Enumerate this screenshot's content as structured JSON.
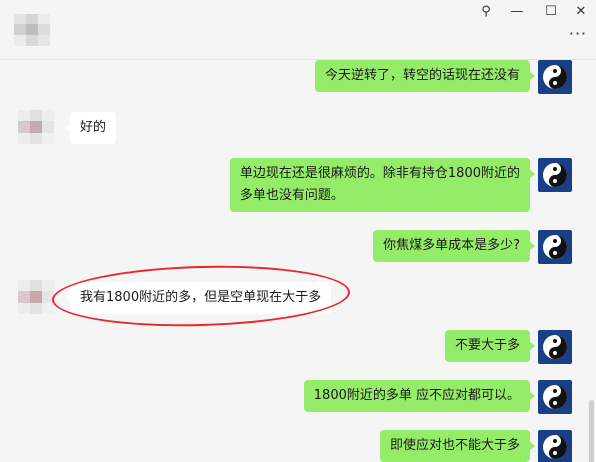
{
  "window": {
    "pin_icon": "pin-icon",
    "minimize_icon": "minimize-icon",
    "maximize_icon": "maximize-icon",
    "close_icon": "close-icon",
    "more_icon": "more-icon"
  },
  "colors": {
    "outgoing_bubble": "#95ec69",
    "incoming_bubble": "#ffffff",
    "background": "#f5f5f5",
    "annotation": "#e8262b"
  },
  "messages": [
    {
      "side": "out",
      "text": "今天逆转了，转空的话现在还没有"
    },
    {
      "side": "in",
      "text": "好的"
    },
    {
      "side": "out",
      "text": "单边现在还是很麻烦的。除非有持仓1800附近的",
      "text2": "多单也没有问题。"
    },
    {
      "side": "out",
      "text": "你焦煤多单成本是多少?"
    },
    {
      "side": "in",
      "text": "我有1800附近的多，但是空单现在大于多"
    },
    {
      "side": "out",
      "text": "不要大于多"
    },
    {
      "side": "out",
      "text": "1800附近的多单 应不应对都可以。"
    },
    {
      "side": "out",
      "text": "即使应对也不能大于多"
    }
  ]
}
